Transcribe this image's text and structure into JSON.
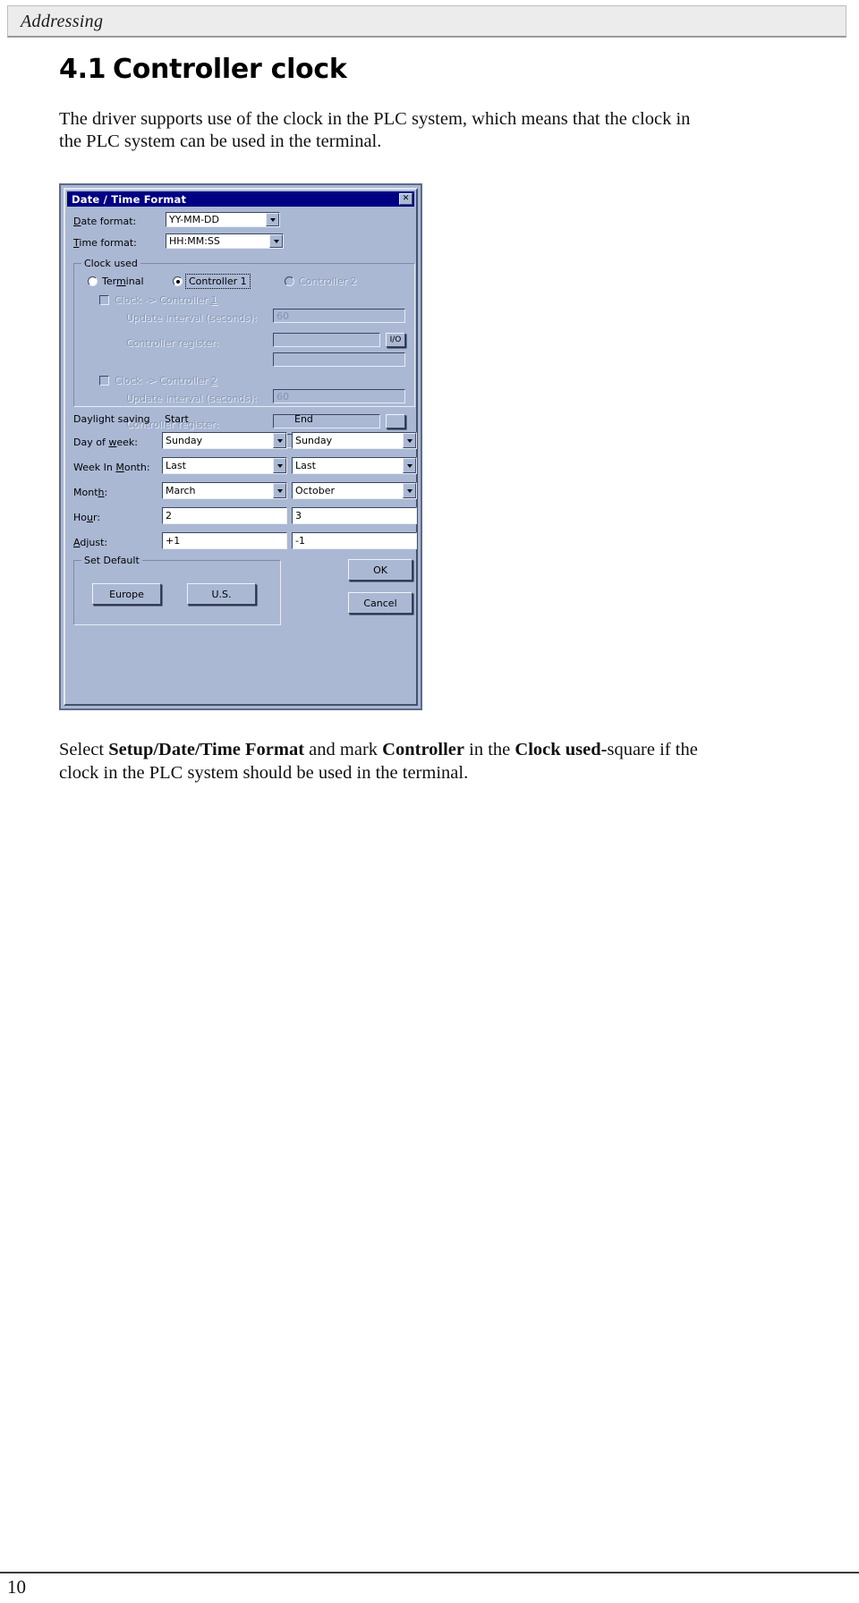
{
  "header": {
    "running_title": "Addressing"
  },
  "heading": {
    "number": "4.1",
    "title": "Controller clock"
  },
  "intro_paragraph": "The driver supports use of the clock in the PLC system, which means that the clock in the PLC system can be used in the terminal.",
  "caption": {
    "part1": "Select ",
    "bold1": "Setup/Date/Time Format",
    "part2": " and mark ",
    "bold2": "Controller",
    "part3": " in the ",
    "bold3": "Clock used-",
    "part4": "square if the clock in the PLC system should be used in the terminal."
  },
  "footer": {
    "page_number": "10"
  },
  "dialog": {
    "title": "Date / Time Format",
    "close_glyph": "✕",
    "date_format": {
      "label": "Date format:",
      "value": "YY-MM-DD"
    },
    "time_format": {
      "label": "Time format:",
      "value": "HH:MM:SS"
    },
    "clock_used": {
      "group_title": "Clock used",
      "radios": [
        {
          "label": "Terminal",
          "selected": false,
          "enabled": true
        },
        {
          "label": "Controller 1",
          "selected": true,
          "enabled": true
        },
        {
          "label": "Controller 2",
          "selected": false,
          "enabled": false
        }
      ],
      "blocks": [
        {
          "checkbox_label": "Clock -> Controller 1",
          "checked": false,
          "interval_label": "Update interval (seconds):",
          "interval_value": "60",
          "register_label": "Controller register:",
          "register_value": "",
          "register_value2": "",
          "picker_button": "I/O"
        },
        {
          "checkbox_label": "Clock -> Controller 2",
          "checked": false,
          "interval_label": "Update interval (seconds):",
          "interval_value": "60",
          "register_label": "Controller register:",
          "register_value": "",
          "register_value2": "",
          "picker_button": ""
        }
      ]
    },
    "daylight": {
      "title": "Daylight saving",
      "col_start": "Start",
      "col_end": "End",
      "rows": [
        {
          "label": "Day of week:",
          "start": "Sunday",
          "end": "Sunday",
          "type": "combo"
        },
        {
          "label": "Week In Month:",
          "start": "Last",
          "end": "Last",
          "type": "combo"
        },
        {
          "label": "Month:",
          "start": "March",
          "end": "October",
          "type": "combo"
        },
        {
          "label": "Hour:",
          "start": "2",
          "end": "3",
          "type": "text"
        },
        {
          "label": "Adjust:",
          "start": "+1",
          "end": "-1",
          "type": "text"
        }
      ]
    },
    "set_default": {
      "group_title": "Set Default",
      "europe_button": "Europe",
      "us_button": "U.S."
    },
    "ok_button": "OK",
    "cancel_button": "Cancel"
  },
  "colors": {
    "title_bar": "#000082",
    "dialog_face": "#aab8d4",
    "header_bg": "#ececec"
  }
}
